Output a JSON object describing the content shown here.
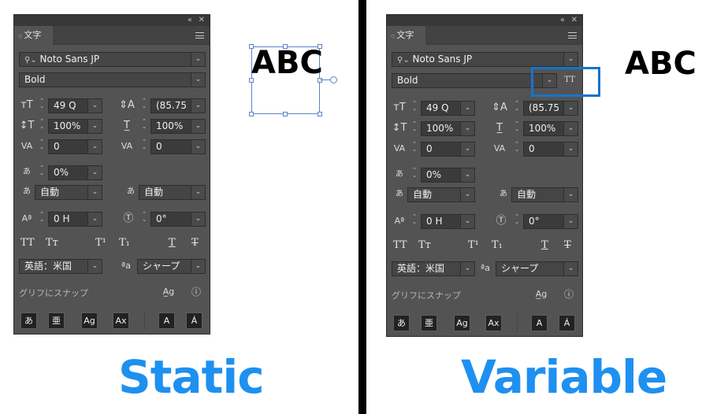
{
  "captions": {
    "left": "Static",
    "right": "Variable"
  },
  "sample_text": "ABC",
  "panel": {
    "tab_label": "文字",
    "font_family": "Noto Sans JP",
    "font_style": "Bold",
    "font_size": "49 Q",
    "leading": "(85.75 H",
    "vertical_scale": "100%",
    "horizontal_scale": "100%",
    "kerning": "0",
    "tracking": "0",
    "tsume": "0%",
    "aki_left": "自動",
    "aki_right": "自動",
    "baseline_shift": "0 H",
    "rotation": "0°",
    "language": "英語：米国",
    "antialias": "シャープ",
    "glyph_snap_label": "グリフにスナップ",
    "bottom_buttons": [
      "あ",
      "亜",
      "Ag",
      "Ax",
      "A",
      "Á"
    ]
  },
  "colors": {
    "caption": "#1e90f0",
    "highlight": "#1774c8",
    "selection": "#5a84c9"
  },
  "icons": {
    "font_size_icon": "tT",
    "variable_font_icon": "TT"
  }
}
